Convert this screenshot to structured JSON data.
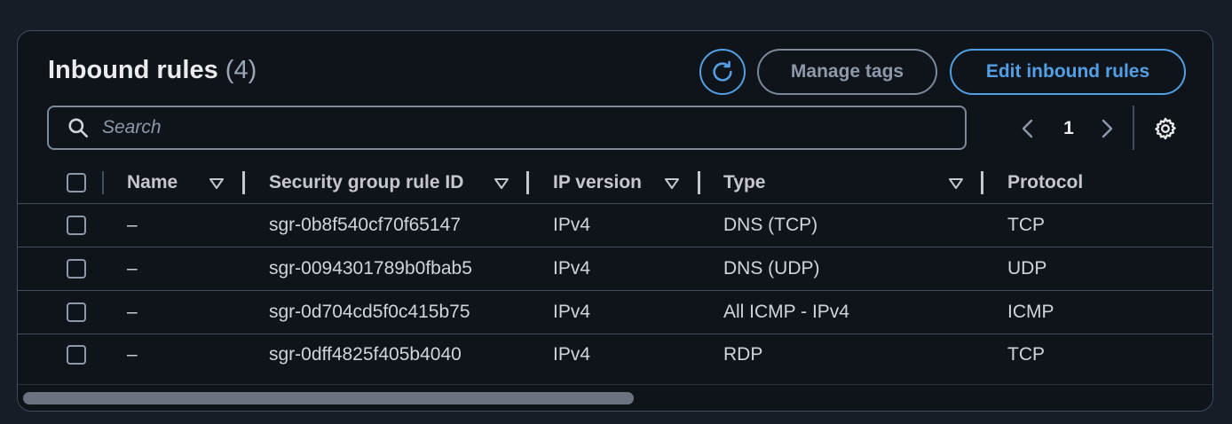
{
  "header": {
    "title": "Inbound rules",
    "count": "(4)",
    "manage_tags_label": "Manage tags",
    "edit_label": "Edit inbound rules"
  },
  "search": {
    "placeholder": "Search"
  },
  "pagination": {
    "current_page": "1"
  },
  "columns": [
    "Name",
    "Security group rule ID",
    "IP version",
    "Type",
    "Protocol"
  ],
  "rows": [
    {
      "name": "–",
      "rule_id": "sgr-0b8f540cf70f65147",
      "ip_version": "IPv4",
      "type": "DNS (TCP)",
      "protocol": "TCP"
    },
    {
      "name": "–",
      "rule_id": "sgr-0094301789b0fbab5",
      "ip_version": "IPv4",
      "type": "DNS (UDP)",
      "protocol": "UDP"
    },
    {
      "name": "–",
      "rule_id": "sgr-0d704cd5f0c415b75",
      "ip_version": "IPv4",
      "type": "All ICMP - IPv4",
      "protocol": "ICMP"
    },
    {
      "name": "–",
      "rule_id": "sgr-0dff4825f405b4040",
      "ip_version": "IPv4",
      "type": "RDP",
      "protocol": "TCP"
    }
  ],
  "colors": {
    "accent": "#539fe5",
    "panel": "#0f141a",
    "border": "#414d5c"
  }
}
